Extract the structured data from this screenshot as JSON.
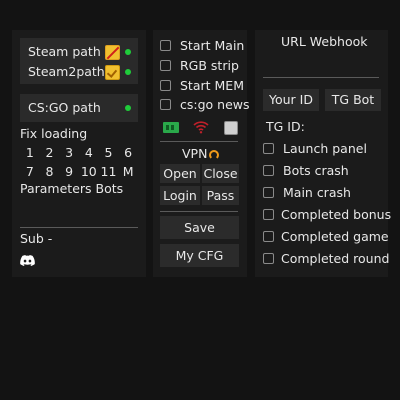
{
  "left_panel": {
    "steam_label": "Steam  path",
    "steam2_label": "Steam2path",
    "csgo_label": "CS:GO path",
    "fix_loading_label": "Fix loading",
    "numbers": [
      "1",
      "2",
      "3",
      "4",
      "5",
      "6",
      "7",
      "8",
      "9",
      "10",
      "11",
      "M"
    ],
    "parameters_label": "Parameters Bots",
    "sub_label": "Sub -",
    "status_color": "#1fcc3a"
  },
  "middle_panel": {
    "checkboxes": [
      "Start Main",
      "RGB strip",
      "Start MEM",
      "cs:go news"
    ],
    "icons": [
      "ram-icon",
      "wifi-icon",
      "square-icon"
    ],
    "vpn_label": "VPN",
    "open_label": "Open",
    "close_label": "Close",
    "login_label": "Login",
    "pass_label": "Pass",
    "save_label": "Save",
    "mycfg_label": "My CFG"
  },
  "right_panel": {
    "webhook_label": "URL Webhook",
    "your_id_label": "Your ID",
    "tg_bot_label": "TG Bot",
    "tg_id_label": "TG ID:",
    "checkboxes": [
      "Launch panel",
      "Bots crash",
      "Main crash",
      "Completed bonus",
      "Completed game",
      "Completed round"
    ]
  }
}
